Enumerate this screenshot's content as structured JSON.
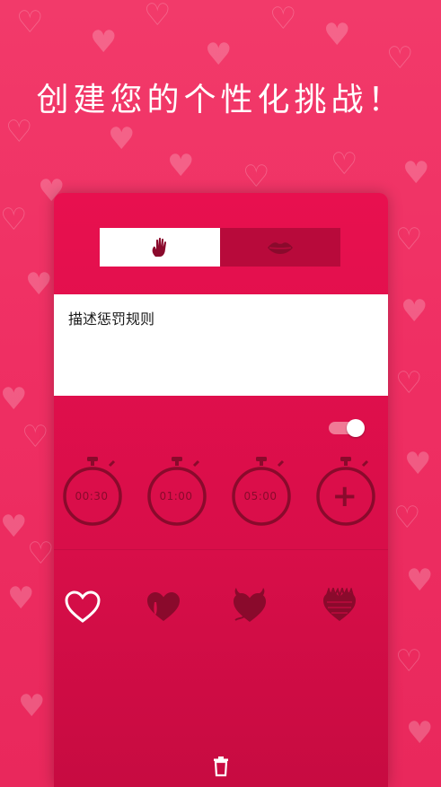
{
  "header": {
    "title": "创建您的个性化挑战！"
  },
  "type_toggle": {
    "options": [
      {
        "icon": "hand-icon",
        "active": true
      },
      {
        "icon": "lips-icon",
        "active": false
      }
    ]
  },
  "rules_input": {
    "value": "描述惩罚规则"
  },
  "switch": {
    "on": true
  },
  "timers": [
    {
      "label": "00:30"
    },
    {
      "label": "01:00"
    },
    {
      "label": "05:00"
    },
    {
      "label": "+",
      "icon": "plus-icon"
    }
  ],
  "hearts": [
    {
      "icon": "heart-outline-icon",
      "selected": true
    },
    {
      "icon": "heart-drip-icon",
      "selected": false
    },
    {
      "icon": "heart-horns-icon",
      "selected": false
    },
    {
      "icon": "heart-scribble-icon",
      "selected": false
    }
  ],
  "footer": {
    "icon": "trash-icon"
  },
  "colors": {
    "background": "#ef2f63",
    "card": "#d80e49",
    "active_segment": "#ffffff",
    "inactive_segment": "#b80a3b",
    "icon_dark": "#8a0a2c",
    "toggle_track": "#f07a96"
  }
}
